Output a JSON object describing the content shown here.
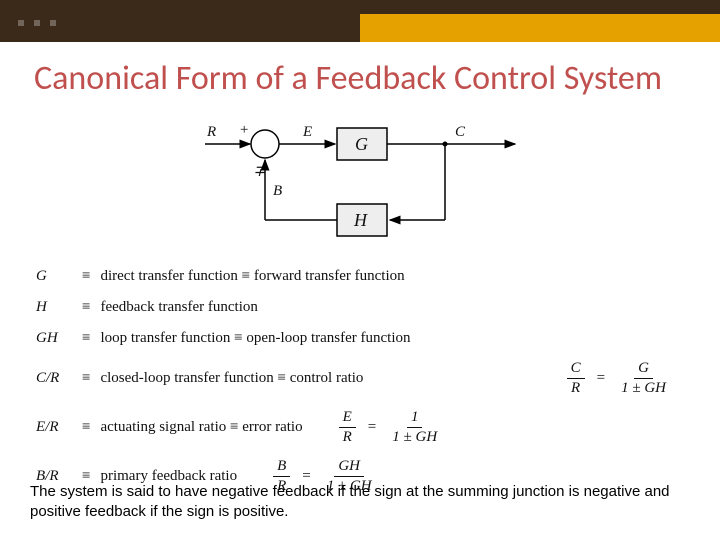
{
  "title": "Canonical Form of a Feedback Control System",
  "diagram": {
    "R": "R",
    "plus": "+",
    "minusplus": "∓",
    "E": "E",
    "G": "G",
    "C": "C",
    "B": "B",
    "H": "H"
  },
  "defs": [
    {
      "sym": "G",
      "text": "direct transfer function ≡ forward transfer function"
    },
    {
      "sym": "H",
      "text": "feedback transfer function"
    },
    {
      "sym": "GH",
      "text": "loop transfer function ≡ open-loop transfer function"
    },
    {
      "sym": "C/R",
      "text": "closed-loop transfer function ≡ control ratio"
    },
    {
      "sym": "E/R",
      "text": "actuating signal ratio ≡ error ratio"
    },
    {
      "sym": "B/R",
      "text": "primary feedback ratio"
    }
  ],
  "formulas": {
    "CR": {
      "lhs_num": "C",
      "lhs_den": "R",
      "rhs_num": "G",
      "rhs_den": "1 ± GH"
    },
    "ER": {
      "lhs_num": "E",
      "lhs_den": "R",
      "rhs_num": "1",
      "rhs_den": "1 ± GH"
    },
    "BR": {
      "lhs_num": "B",
      "lhs_den": "R",
      "rhs_num": "GH",
      "rhs_den": "1 ± GH"
    }
  },
  "footer": "The system is said to have negative feedback if the sign at the summing junction is negative and positive feedback if the sign is positive.",
  "eqv": "≡",
  "eq": "="
}
